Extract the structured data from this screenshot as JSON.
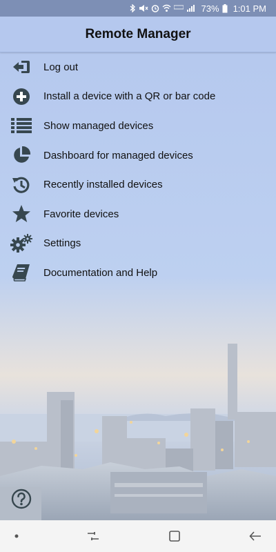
{
  "status_bar": {
    "battery_percent": "73%",
    "time": "1:01 PM",
    "icons": [
      "bluetooth-icon",
      "mute-icon",
      "alarm-icon",
      "wifi-icon",
      "lte-icon",
      "signal-icon",
      "battery-icon"
    ]
  },
  "header": {
    "title": "Remote Manager"
  },
  "menu": {
    "items": [
      {
        "label": "Log out",
        "icon": "logout-icon"
      },
      {
        "label": "Install a device with a QR or bar code",
        "icon": "plus-circle-icon"
      },
      {
        "label": "Show managed devices",
        "icon": "list-icon"
      },
      {
        "label": "Dashboard for managed devices",
        "icon": "pie-chart-icon"
      },
      {
        "label": "Recently installed devices",
        "icon": "history-icon"
      },
      {
        "label": "Favorite devices",
        "icon": "star-icon"
      },
      {
        "label": "Settings",
        "icon": "gears-icon"
      },
      {
        "label": "Documentation and Help",
        "icon": "book-icon"
      }
    ]
  },
  "help": {
    "icon": "help-icon"
  },
  "nav_bar": {
    "icons": [
      "dot-icon",
      "recent-apps-icon",
      "home-icon",
      "back-icon"
    ]
  },
  "colors": {
    "icon": "#37474f",
    "header_bg": "#b5c8ee",
    "status_bg": "#7d8fb5"
  }
}
